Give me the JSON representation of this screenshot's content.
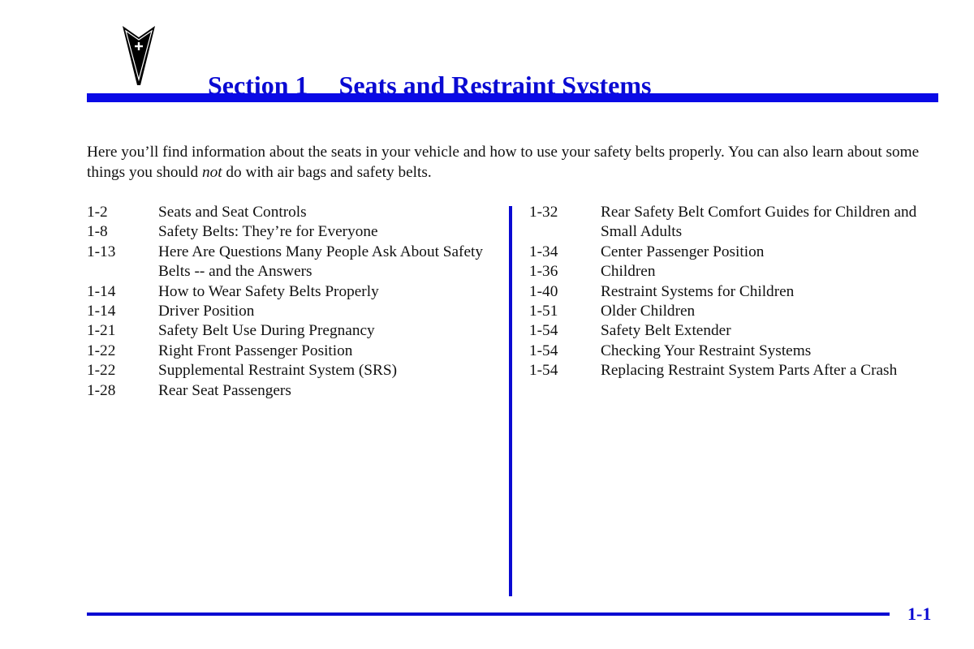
{
  "header": {
    "logo_icon": "arrowhead-emblem-icon",
    "section_number": "Section 1",
    "section_title": "Seats and Restraint Systems",
    "accent_color": "#0a0ad2"
  },
  "intro": {
    "text_before": "Here you’ll find information about the seats in your vehicle and how to use your safety belts properly. You can also learn about some things you should ",
    "emphasis": "not",
    "text_after": " do with air bags and safety belts."
  },
  "toc": {
    "left": [
      {
        "page": "1-2",
        "title": "Seats and Seat Controls"
      },
      {
        "page": "1-8",
        "title": "Safety Belts: They’re for Everyone"
      },
      {
        "page": "1-13",
        "title": "Here Are Questions Many People Ask About Safety Belts -- and the Answers"
      },
      {
        "page": "1-14",
        "title": "How to Wear Safety Belts Properly"
      },
      {
        "page": "1-14",
        "title": "Driver Position"
      },
      {
        "page": "1-21",
        "title": "Safety Belt Use During Pregnancy"
      },
      {
        "page": "1-22",
        "title": "Right Front Passenger Position"
      },
      {
        "page": "1-22",
        "title": "Supplemental Restraint System (SRS)"
      },
      {
        "page": "1-28",
        "title": "Rear Seat Passengers"
      }
    ],
    "right": [
      {
        "page": "1-32",
        "title": "Rear Safety Belt Comfort Guides for Children and Small Adults"
      },
      {
        "page": "1-34",
        "title": "Center Passenger Position"
      },
      {
        "page": "1-36",
        "title": "Children"
      },
      {
        "page": "1-40",
        "title": "Restraint Systems for Children"
      },
      {
        "page": "1-51",
        "title": "Older Children"
      },
      {
        "page": "1-54",
        "title": "Safety Belt Extender"
      },
      {
        "page": "1-54",
        "title": "Checking Your Restraint Systems"
      },
      {
        "page": "1-54",
        "title": "Replacing Restraint System Parts After a Crash"
      }
    ]
  },
  "footer": {
    "page_number": "1-1"
  }
}
